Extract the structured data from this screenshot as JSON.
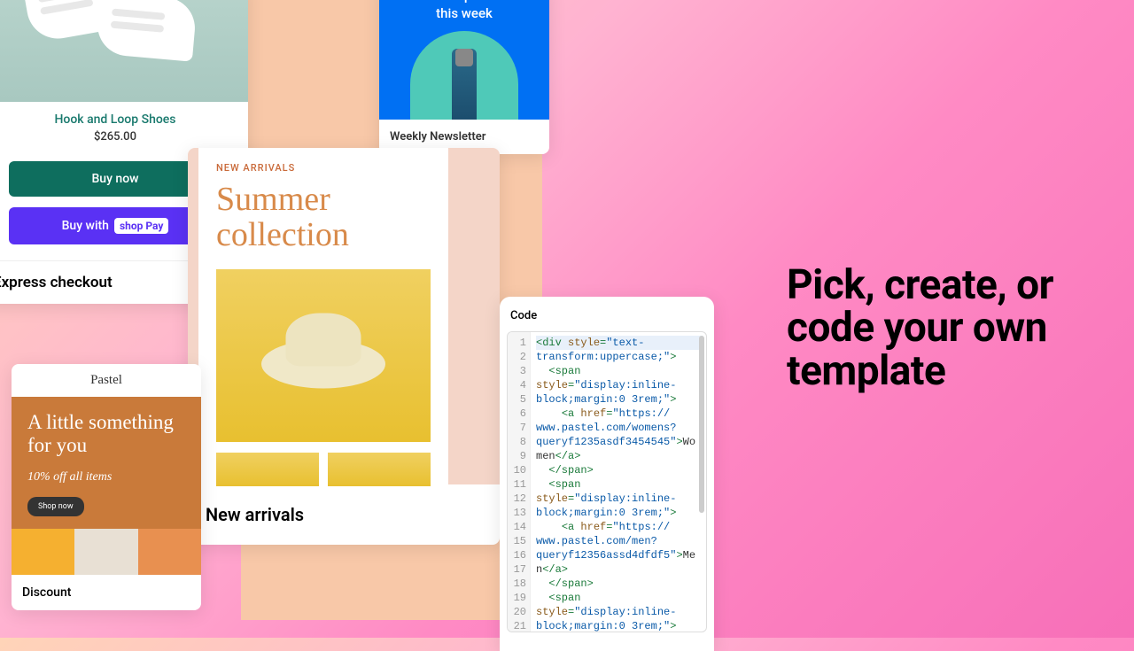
{
  "headline": "Pick, create, or code your own template",
  "express": {
    "product_name": "Hook and Loop Shoes",
    "price": "$265.00",
    "buy_label": "Buy now",
    "buywith_label": "Buy with",
    "shoppay_label": "shop Pay",
    "card_label": "Express checkout"
  },
  "newsletter": {
    "title": "Hot new products this week",
    "card_label": "Weekly Newsletter"
  },
  "arrivals": {
    "tag": "NEW ARRIVALS",
    "title": "Summer collection",
    "card_label": "New arrivals"
  },
  "discount": {
    "logo": "Pastel",
    "heading": "A little something for you",
    "sub": "10% off all items",
    "btn": "Shop now",
    "card_label": "Discount"
  },
  "code": {
    "label": "Code",
    "lines": [
      {
        "n": "1",
        "seg": [
          [
            "t-tag",
            "<div "
          ],
          [
            "t-attr",
            "style"
          ],
          [
            "t-tag",
            "="
          ],
          [
            "t-str",
            "\"text-"
          ]
        ]
      },
      {
        "n": "2",
        "seg": [
          [
            "t-str",
            "transform:uppercase;\""
          ],
          [
            "t-tag",
            ">"
          ]
        ]
      },
      {
        "n": "3",
        "seg": [
          [
            "t-txt",
            "  "
          ],
          [
            "t-tag",
            "<span"
          ]
        ]
      },
      {
        "n": "4",
        "seg": [
          [
            "t-attr",
            "style"
          ],
          [
            "t-tag",
            "="
          ],
          [
            "t-str",
            "\"display:inline-"
          ]
        ]
      },
      {
        "n": "5",
        "seg": [
          [
            "t-str",
            "block;margin:0 3rem;\""
          ],
          [
            "t-tag",
            ">"
          ]
        ]
      },
      {
        "n": "6",
        "seg": [
          [
            "t-txt",
            "    "
          ],
          [
            "t-tag",
            "<a "
          ],
          [
            "t-attr",
            "href"
          ],
          [
            "t-tag",
            "="
          ],
          [
            "t-str",
            "\"https://"
          ]
        ]
      },
      {
        "n": "7",
        "seg": [
          [
            "t-str",
            "www.pastel.com/womens?"
          ]
        ]
      },
      {
        "n": "8",
        "seg": [
          [
            "t-str",
            "queryf1235asdf3454545\""
          ],
          [
            "t-tag",
            ">"
          ],
          [
            "t-txt",
            "Wo"
          ]
        ]
      },
      {
        "n": "9",
        "seg": [
          [
            "t-txt",
            "men"
          ],
          [
            "t-tag",
            "</a>"
          ]
        ]
      },
      {
        "n": "10",
        "seg": [
          [
            "t-txt",
            "  "
          ],
          [
            "t-tag",
            "</span>"
          ]
        ]
      },
      {
        "n": "11",
        "seg": [
          [
            "t-txt",
            "  "
          ],
          [
            "t-tag",
            "<span"
          ]
        ]
      },
      {
        "n": "12",
        "seg": [
          [
            "t-attr",
            "style"
          ],
          [
            "t-tag",
            "="
          ],
          [
            "t-str",
            "\"display:inline-"
          ]
        ]
      },
      {
        "n": "13",
        "seg": [
          [
            "t-str",
            "block;margin:0 3rem;\""
          ],
          [
            "t-tag",
            ">"
          ]
        ]
      },
      {
        "n": "14",
        "seg": [
          [
            "t-txt",
            "    "
          ],
          [
            "t-tag",
            "<a "
          ],
          [
            "t-attr",
            "href"
          ],
          [
            "t-tag",
            "="
          ],
          [
            "t-str",
            "\"https://"
          ]
        ]
      },
      {
        "n": "15",
        "seg": [
          [
            "t-str",
            "www.pastel.com/men?"
          ]
        ]
      },
      {
        "n": "16",
        "seg": [
          [
            "t-str",
            "queryf12356assd4dfdf5\""
          ],
          [
            "t-tag",
            ">"
          ],
          [
            "t-txt",
            "Me"
          ]
        ]
      },
      {
        "n": "17",
        "seg": [
          [
            "t-txt",
            "n"
          ],
          [
            "t-tag",
            "</a>"
          ]
        ]
      },
      {
        "n": "18",
        "seg": [
          [
            "t-txt",
            "  "
          ],
          [
            "t-tag",
            "</span>"
          ]
        ]
      },
      {
        "n": "19",
        "seg": [
          [
            "t-txt",
            "  "
          ],
          [
            "t-tag",
            "<span"
          ]
        ]
      },
      {
        "n": "20",
        "seg": [
          [
            "t-attr",
            "style"
          ],
          [
            "t-tag",
            "="
          ],
          [
            "t-str",
            "\"display:inline-"
          ]
        ]
      },
      {
        "n": "21",
        "seg": [
          [
            "t-str",
            "block;margin:0 3rem;\""
          ],
          [
            "t-tag",
            ">"
          ]
        ]
      }
    ]
  }
}
